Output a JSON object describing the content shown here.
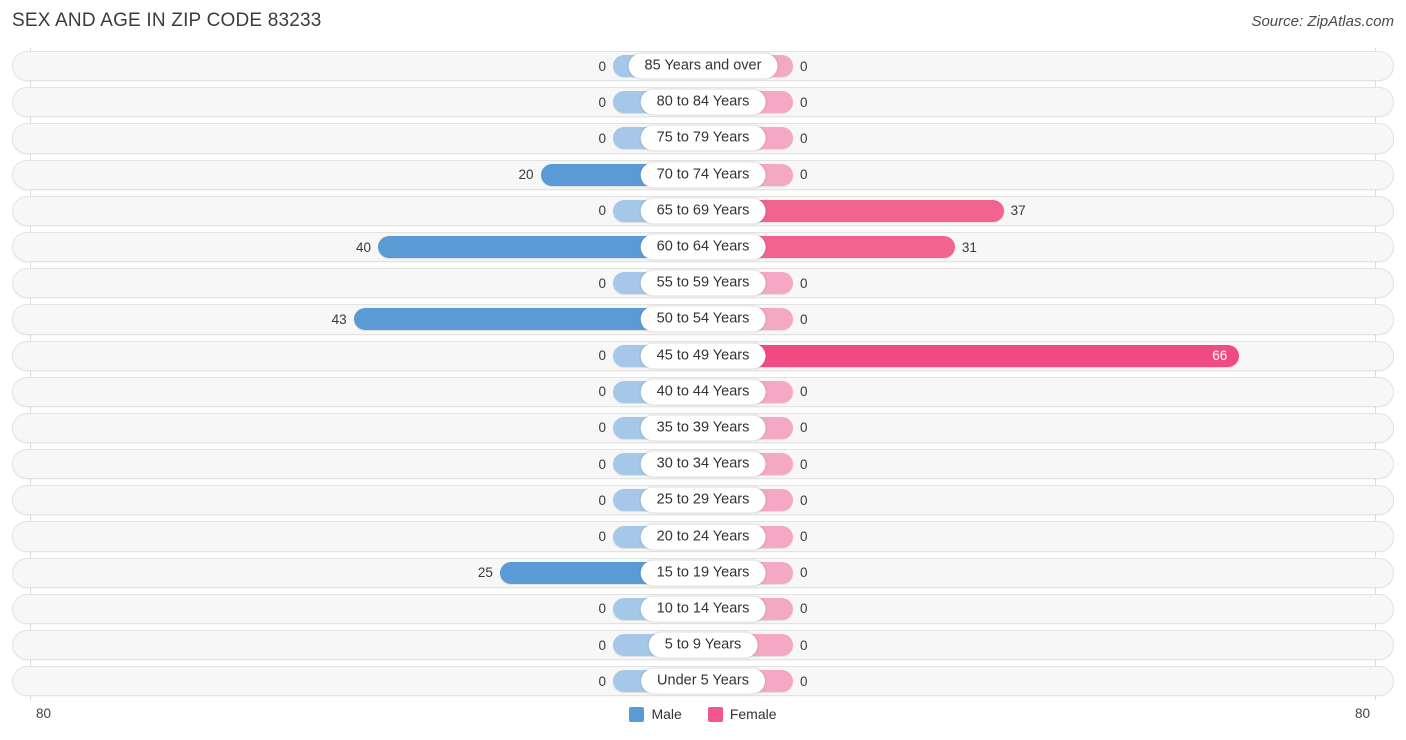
{
  "header": {
    "title": "SEX AND AGE IN ZIP CODE 83233",
    "source": "Source: ZipAtlas.com"
  },
  "legend": {
    "male_label": "Male",
    "female_label": "Female",
    "male_color": "#5B9BD5",
    "female_color": "#F2568F"
  },
  "axis": {
    "left_max_label": "80",
    "right_max_label": "80"
  },
  "colors": {
    "male_active": "#5B9BD5",
    "male_zero": "#A5C8E8",
    "female_active": "#F2648F",
    "female_strong": "#F04A82",
    "female_zero": "#F5A8C4",
    "track_bg": "#F7F7F7",
    "track_border": "#E3E3E3",
    "gridline": "#DCDCDC"
  },
  "chart_data": {
    "type": "bar",
    "subtype": "population-pyramid",
    "title": "SEX AND AGE IN ZIP CODE 83233",
    "xlabel": "",
    "ylabel": "",
    "xlim": [
      80,
      80
    ],
    "grid": true,
    "legend_position": "bottom-center",
    "categories": [
      "85 Years and over",
      "80 to 84 Years",
      "75 to 79 Years",
      "70 to 74 Years",
      "65 to 69 Years",
      "60 to 64 Years",
      "55 to 59 Years",
      "50 to 54 Years",
      "45 to 49 Years",
      "40 to 44 Years",
      "35 to 39 Years",
      "30 to 34 Years",
      "25 to 29 Years",
      "20 to 24 Years",
      "15 to 19 Years",
      "10 to 14 Years",
      "5 to 9 Years",
      "Under 5 Years"
    ],
    "series": [
      {
        "name": "Male",
        "side": "left",
        "color": "#5B9BD5",
        "values": [
          0,
          0,
          0,
          20,
          0,
          40,
          0,
          43,
          0,
          0,
          0,
          0,
          0,
          0,
          25,
          0,
          0,
          0
        ]
      },
      {
        "name": "Female",
        "side": "right",
        "color": "#F2568F",
        "values": [
          0,
          0,
          0,
          0,
          37,
          31,
          0,
          0,
          66,
          0,
          0,
          0,
          0,
          0,
          0,
          0,
          0,
          0
        ]
      }
    ]
  },
  "rows": [
    {
      "label": "85 Years and over",
      "male": "0",
      "female": "0"
    },
    {
      "label": "80 to 84 Years",
      "male": "0",
      "female": "0"
    },
    {
      "label": "75 to 79 Years",
      "male": "0",
      "female": "0"
    },
    {
      "label": "70 to 74 Years",
      "male": "20",
      "female": "0"
    },
    {
      "label": "65 to 69 Years",
      "male": "0",
      "female": "37"
    },
    {
      "label": "60 to 64 Years",
      "male": "40",
      "female": "31"
    },
    {
      "label": "55 to 59 Years",
      "male": "0",
      "female": "0"
    },
    {
      "label": "50 to 54 Years",
      "male": "43",
      "female": "0"
    },
    {
      "label": "45 to 49 Years",
      "male": "0",
      "female": "66"
    },
    {
      "label": "40 to 44 Years",
      "male": "0",
      "female": "0"
    },
    {
      "label": "35 to 39 Years",
      "male": "0",
      "female": "0"
    },
    {
      "label": "30 to 34 Years",
      "male": "0",
      "female": "0"
    },
    {
      "label": "25 to 29 Years",
      "male": "0",
      "female": "0"
    },
    {
      "label": "20 to 24 Years",
      "male": "0",
      "female": "0"
    },
    {
      "label": "15 to 19 Years",
      "male": "25",
      "female": "0"
    },
    {
      "label": "10 to 14 Years",
      "male": "0",
      "female": "0"
    },
    {
      "label": "5 to 9 Years",
      "male": "0",
      "female": "0"
    },
    {
      "label": "Under 5 Years",
      "male": "0",
      "female": "0"
    }
  ]
}
